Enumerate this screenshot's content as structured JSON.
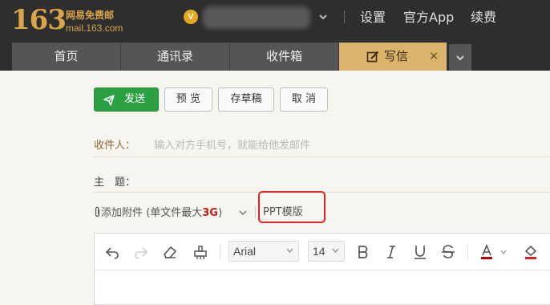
{
  "brand": {
    "logo_number": "163",
    "logo_name": "网易免费邮",
    "logo_domain": "mail.163.com"
  },
  "account": {
    "vip_badge": "V"
  },
  "header_links": [
    "设置",
    "官方App",
    "续费"
  ],
  "tabs": [
    {
      "label": "首页"
    },
    {
      "label": "通讯录"
    },
    {
      "label": "收件箱"
    },
    {
      "label": "写信",
      "close": "×"
    }
  ],
  "toolbar": {
    "send": "发送",
    "preview": "预 览",
    "save_draft": "存草稿",
    "cancel": "取 消"
  },
  "form": {
    "recipient_label": "收件人：",
    "recipient_placeholder": "输入对方手机号，就能给他发邮件",
    "subject_label": "主　题：",
    "attach_label": "添加附件",
    "attach_note_prefix": "(单文件最大",
    "attach_note_size": "3G",
    "attach_note_suffix": ")",
    "ppt_template": "PPT模版"
  },
  "editor": {
    "font_family": "Arial",
    "font_size": "14",
    "icons": [
      "undo-icon",
      "redo-icon",
      "eraser-icon",
      "format-painter-icon",
      "bold-icon",
      "italic-icon",
      "underline-icon",
      "strikethrough-icon",
      "font-color-icon",
      "highlight-color-icon"
    ],
    "font_color": "#c00000",
    "highlight_color": "#e02020"
  },
  "colors": {
    "header_bg": "#2e2e2e",
    "tab_bg": "#555555",
    "tab_active_bg": "#d9b46a",
    "send_green": "#2ca143",
    "annotation_red": "#e52521"
  }
}
